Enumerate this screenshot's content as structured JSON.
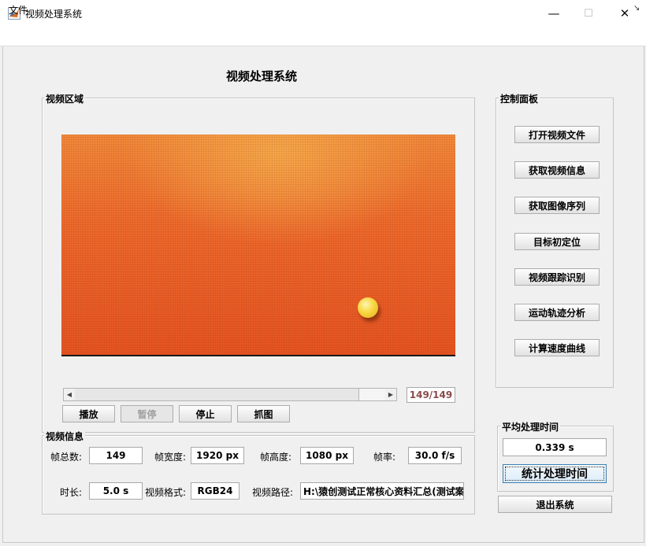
{
  "window": {
    "title": "视频处理系统",
    "minimize_symbol": "—",
    "maximize_symbol": "☐",
    "close_symbol": "✕"
  },
  "menu": {
    "file_label": "文件",
    "overflow_symbol": "↘"
  },
  "main_title": "视频处理系统",
  "video_panel": {
    "title": "视频区域",
    "slider": {
      "position_fraction": 1.0
    },
    "frame_counter": "149/149",
    "buttons": {
      "play": "播放",
      "pause": "暂停",
      "stop": "停止",
      "capture": "抓图"
    }
  },
  "control_panel": {
    "title": "控制面板",
    "buttons": [
      "打开视频文件",
      "获取视频信息",
      "获取图像序列",
      "目标初定位",
      "视频跟踪识别",
      "运动轨迹分析",
      "计算速度曲线"
    ]
  },
  "info_panel": {
    "title": "视频信息",
    "total_frames_label": "帧总数:",
    "total_frames": "149",
    "width_label": "帧宽度:",
    "width": "1920 px",
    "height_label": "帧高度:",
    "height": "1080 px",
    "fps_label": "帧率:",
    "fps": "30.0 f/s",
    "duration_label": "时长:",
    "duration": "5.0 s",
    "format_label": "视频格式:",
    "format": "RGB24",
    "path_label": "视频路径:",
    "path": "H:\\猿创测试正常核心资料汇总(测试案例"
  },
  "timing_panel": {
    "title": "平均处理时间",
    "value": "0.339 s",
    "button": "统计处理时间"
  },
  "exit_button": "退出系统",
  "colors": {
    "accent_focus": "#3c7fb1",
    "frame_counter_text": "#8a4a4a"
  }
}
